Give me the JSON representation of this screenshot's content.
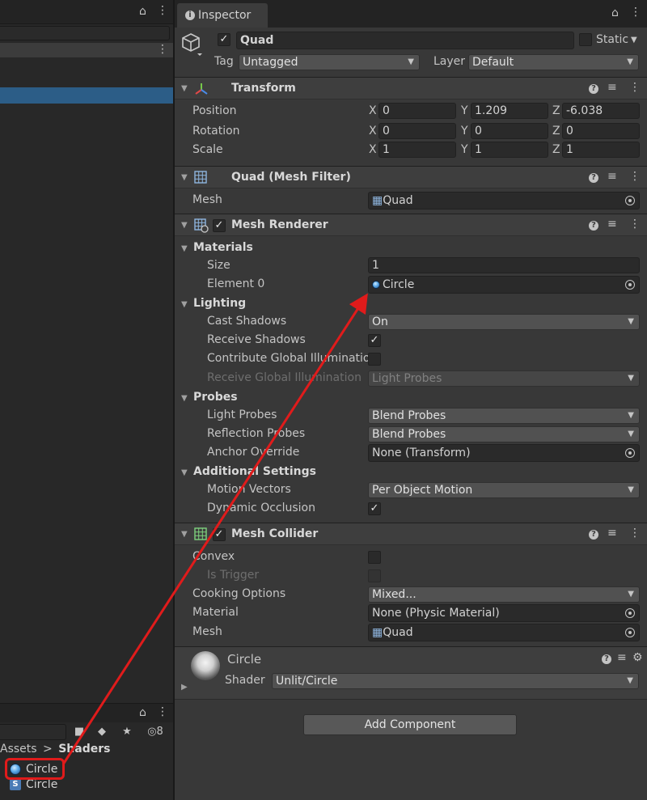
{
  "colors": {
    "accent": "#2c5d87",
    "annotation": "#e01b1b",
    "panel": "#383838"
  },
  "left_panel": {
    "breadcrumb": {
      "parent": "Assets",
      "separator": ">",
      "current": "Shaders"
    },
    "hidden_count": "8",
    "assets": [
      {
        "name": "Circle",
        "icon": "material-icon"
      },
      {
        "name": "Circle",
        "icon": "shader-icon"
      }
    ]
  },
  "inspector": {
    "tab_label": "Inspector",
    "object": {
      "name": "Quad",
      "static_label": "Static",
      "tag_label": "Tag",
      "tag_value": "Untagged",
      "layer_label": "Layer",
      "layer_value": "Default"
    },
    "transform": {
      "title": "Transform",
      "position_label": "Position",
      "rotation_label": "Rotation",
      "scale_label": "Scale",
      "axis_x": "X",
      "axis_y": "Y",
      "axis_z": "Z",
      "position": [
        "0",
        "1.209",
        "-6.038"
      ],
      "rotation": [
        "0",
        "0",
        "0"
      ],
      "scale": [
        "1",
        "1",
        "1"
      ]
    },
    "mesh_filter": {
      "title": "Quad (Mesh Filter)",
      "mesh_label": "Mesh",
      "mesh_value": "Quad"
    },
    "mesh_renderer": {
      "title": "Mesh Renderer",
      "materials_label": "Materials",
      "size_label": "Size",
      "size_value": "1",
      "element0_label": "Element 0",
      "element0_value": "Circle",
      "lighting_label": "Lighting",
      "cast_shadows_label": "Cast Shadows",
      "cast_shadows_value": "On",
      "receive_shadows_label": "Receive Shadows",
      "receive_shadows_checked": true,
      "contribute_gi_label": "Contribute Global Illumination",
      "contribute_gi_checked": false,
      "receive_gi_label": "Receive Global Illumination",
      "receive_gi_value": "Light Probes",
      "probes_label": "Probes",
      "light_probes_label": "Light Probes",
      "light_probes_value": "Blend Probes",
      "reflection_probes_label": "Reflection Probes",
      "reflection_probes_value": "Blend Probes",
      "anchor_override_label": "Anchor Override",
      "anchor_override_value": "None (Transform)",
      "additional_label": "Additional Settings",
      "motion_vectors_label": "Motion Vectors",
      "motion_vectors_value": "Per Object Motion",
      "dynamic_occlusion_label": "Dynamic Occlusion",
      "dynamic_occlusion_checked": true
    },
    "mesh_collider": {
      "title": "Mesh Collider",
      "convex_label": "Convex",
      "convex_checked": false,
      "is_trigger_label": "Is Trigger",
      "is_trigger_checked": false,
      "cooking_label": "Cooking Options",
      "cooking_value": "Mixed...",
      "material_label": "Material",
      "material_value": "None (Physic Material)",
      "mesh_label": "Mesh",
      "mesh_value": "Quad"
    },
    "material_preview": {
      "name": "Circle",
      "shader_label": "Shader",
      "shader_value": "Unlit/Circle"
    },
    "add_component_label": "Add Component"
  }
}
